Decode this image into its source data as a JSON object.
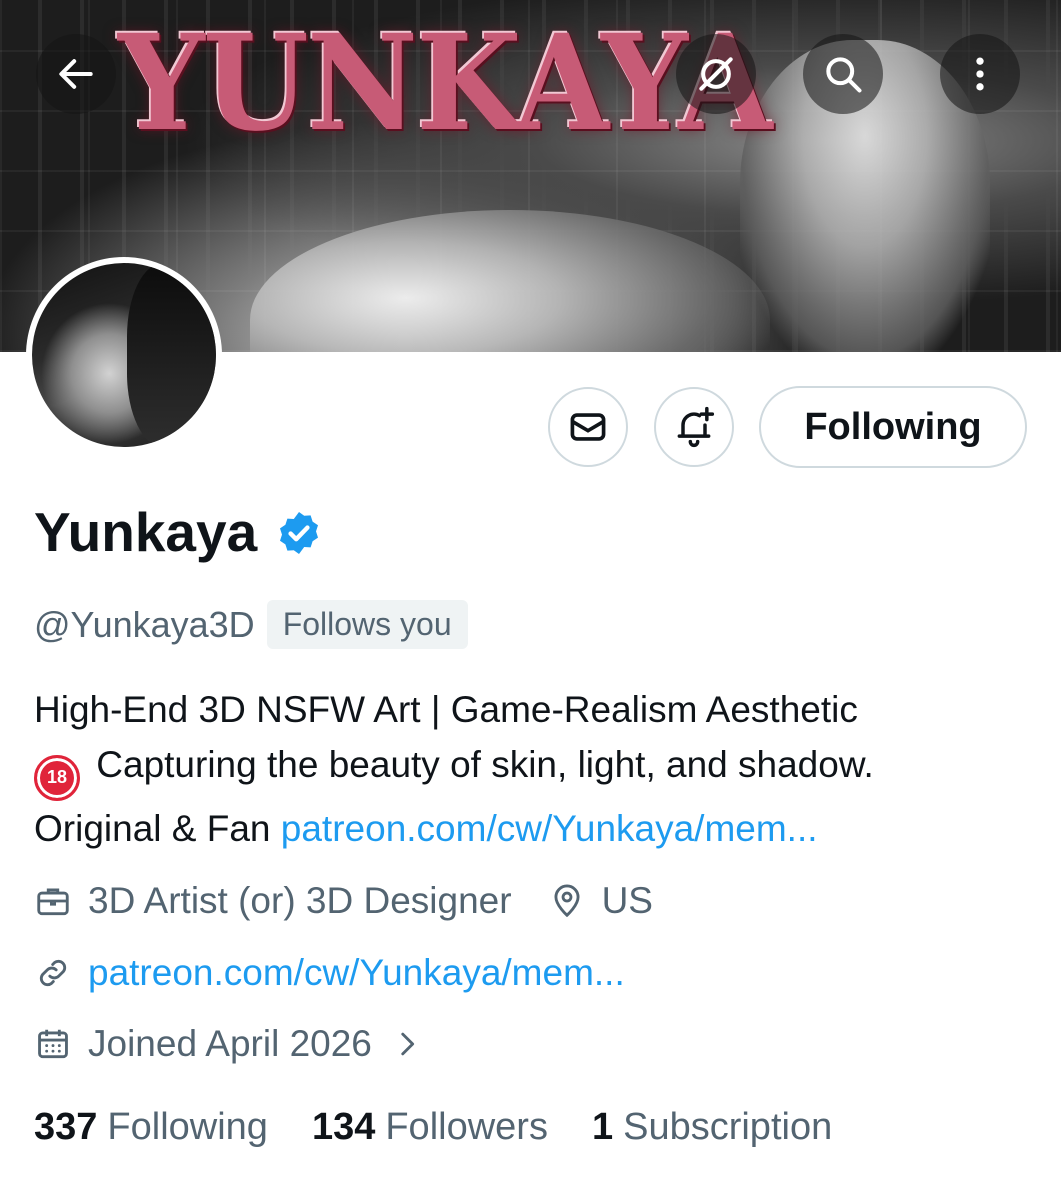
{
  "banner": {
    "logo_text": "YUNKAYA"
  },
  "header": {
    "back_icon": "arrow-left-icon",
    "grok_icon": "slash-circle-icon",
    "search_icon": "search-icon",
    "more_icon": "more-vertical-icon"
  },
  "actions": {
    "message_icon": "envelope-icon",
    "notify_icon": "bell-plus-icon",
    "following_label": "Following"
  },
  "profile": {
    "display_name": "Yunkaya",
    "verified": true,
    "handle": "@Yunkaya3D",
    "follows_you": "Follows you",
    "bio_line1": "High-End 3D NSFW Art | Game-Realism Aesthetic",
    "bio_badge": "18",
    "bio_line2": "Capturing the beauty of skin, light, and shadow.",
    "bio_line3_prefix": "Original & Fan ",
    "bio_link": "patreon.com/cw/Yunkaya/mem...",
    "profession": "3D Artist (or) 3D Designer",
    "location": "US",
    "website": "patreon.com/cw/Yunkaya/mem...",
    "joined": "Joined April 2026"
  },
  "stats": {
    "following_count": "337",
    "following_label": "Following",
    "followers_count": "134",
    "followers_label": "Followers",
    "subscription_count": "1",
    "subscription_label": "Subscription"
  },
  "colors": {
    "link": "#1d9bf0",
    "secondary_text": "#536471",
    "primary_text": "#0f1419",
    "border": "#cfd9de"
  }
}
